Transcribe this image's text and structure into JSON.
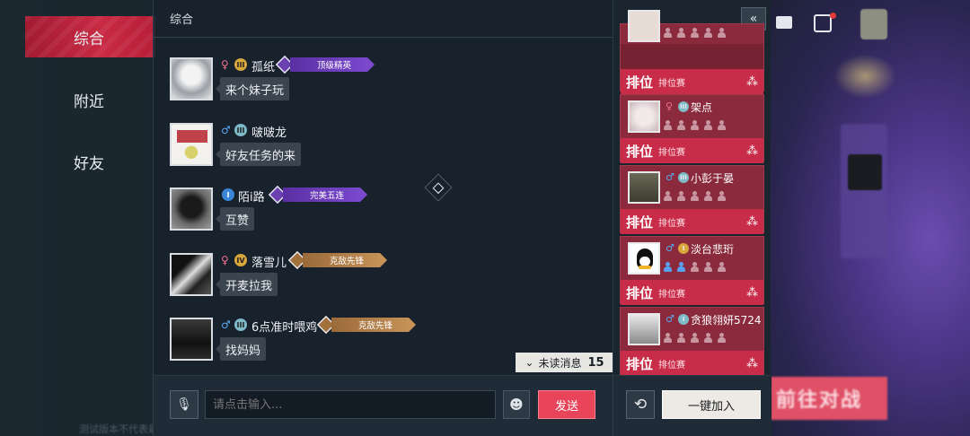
{
  "nav": {
    "items": [
      {
        "label": "综合",
        "active": true
      },
      {
        "label": "附近",
        "active": false
      },
      {
        "label": "好友",
        "active": false
      }
    ]
  },
  "chat": {
    "channel_title": "综合",
    "messages": [
      {
        "gender": "♀",
        "gender_type": "female",
        "rank": "III",
        "rank_color": "gold",
        "name": "孤纸",
        "title": "顶级精英",
        "title_style": "purple",
        "text": "来个妹子玩"
      },
      {
        "gender": "♂",
        "gender_type": "male",
        "rank": "III",
        "rank_color": "teal",
        "name": "啵啵龙",
        "title": "",
        "title_style": "",
        "text": "好友任务的来"
      },
      {
        "gender": "",
        "gender_type": "",
        "rank": "I",
        "rank_color": "blue",
        "name": "陌i路",
        "title": "完美五连",
        "title_style": "purple",
        "text": "互赞"
      },
      {
        "gender": "♀",
        "gender_type": "female",
        "rank": "IV",
        "rank_color": "gold",
        "name": "落雪儿",
        "title": "克敌先锋",
        "title_style": "gold",
        "text": "开麦拉我"
      },
      {
        "gender": "♂",
        "gender_type": "male",
        "rank": "III",
        "rank_color": "teal",
        "name": "6点准时喂鸡",
        "title": "克敌先锋",
        "title_style": "gold",
        "text": "找妈妈"
      }
    ],
    "unread_label": "未读消息",
    "unread_count": "15",
    "input_placeholder": "请点击输入...",
    "send_label": "发送"
  },
  "teams": {
    "cards": [
      {
        "gender": "",
        "gender_type": "",
        "rank": "",
        "rank_color": "",
        "name": "",
        "slots_filled": 0,
        "mode": "排位",
        "sub": "排位赛"
      },
      {
        "gender": "♀",
        "gender_type": "female",
        "rank": "III",
        "rank_color": "teal",
        "name": "架点",
        "slots_filled": 0,
        "mode": "排位",
        "sub": "排位赛"
      },
      {
        "gender": "♂",
        "gender_type": "male",
        "rank": "III",
        "rank_color": "teal",
        "name": "小彭于晏",
        "slots_filled": 0,
        "mode": "排位",
        "sub": "排位赛"
      },
      {
        "gender": "♂",
        "gender_type": "male",
        "rank": "I",
        "rank_color": "gold",
        "name": "淡台悲珩",
        "slots_filled": 2,
        "mode": "排位",
        "sub": "排位赛"
      },
      {
        "gender": "♂",
        "gender_type": "male",
        "rank": "I",
        "rank_color": "teal",
        "name": "贪狼翎妍5724",
        "slots_filled": 0,
        "mode": "排位",
        "sub": "排位赛"
      }
    ],
    "join_label": "一键加入"
  },
  "background": {
    "battle_label": "前往对战",
    "watermark": "测试版本不代表最终品质"
  },
  "colors": {
    "accent": "#c92a44",
    "send": "#e8445a",
    "card": "#c82c48"
  }
}
